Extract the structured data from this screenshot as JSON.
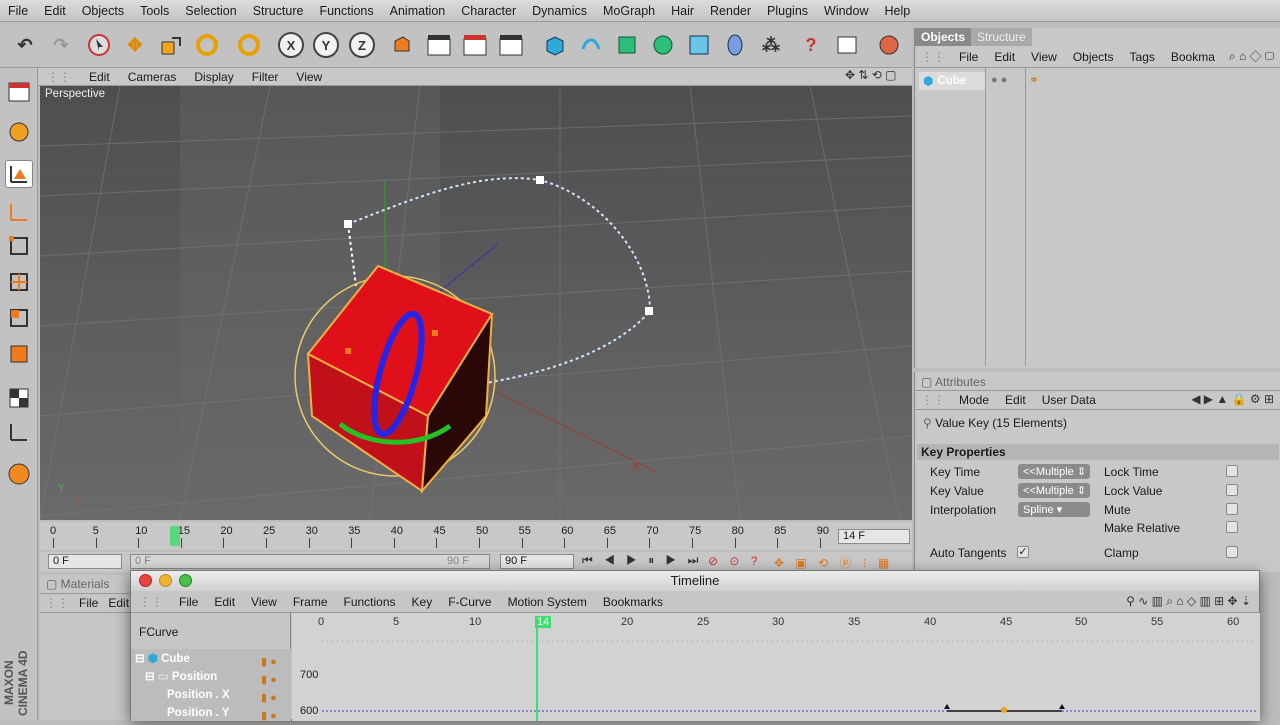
{
  "menu": [
    "File",
    "Edit",
    "Objects",
    "Tools",
    "Selection",
    "Structure",
    "Functions",
    "Animation",
    "Character",
    "Dynamics",
    "MoGraph",
    "Hair",
    "Render",
    "Plugins",
    "Window",
    "Help"
  ],
  "toolbar": {
    "x_label": "X",
    "y_label": "Y",
    "z_label": "Z"
  },
  "viewport": {
    "menu": [
      "Edit",
      "Cameras",
      "Display",
      "Filter",
      "View"
    ],
    "label": "Perspective"
  },
  "ruler": {
    "ticks": [
      "0",
      "5",
      "10",
      "15",
      "20",
      "25",
      "30",
      "35",
      "40",
      "45",
      "50",
      "55",
      "60",
      "65",
      "70",
      "75",
      "80",
      "85",
      "90"
    ],
    "current_frame": "14 F"
  },
  "transport": {
    "start": "0 F",
    "min": "0 F",
    "max": "90 F",
    "end": "90 F"
  },
  "objects_panel": {
    "tabs": [
      "Objects",
      "Structure"
    ],
    "menu": [
      "File",
      "Edit",
      "View",
      "Objects",
      "Tags",
      "Bookma"
    ],
    "object_name": "Cube"
  },
  "attributes": {
    "title": "Attributes",
    "menu": [
      "Mode",
      "Edit",
      "User Data"
    ],
    "header": "Value Key (15 Elements)",
    "section": "Key Properties",
    "key_time_label": "Key Time",
    "key_time_value": "<<Multiple",
    "key_value_label": "Key Value",
    "key_value_value": "<<Multiple",
    "interpolation_label": "Interpolation",
    "interpolation_value": "Spline",
    "lock_time": "Lock Time",
    "lock_value": "Lock Value",
    "mute": "Mute",
    "make_relative": "Make Relative",
    "auto_tangents": "Auto Tangents",
    "clamp": "Clamp"
  },
  "materials": {
    "title": "Materials",
    "menu": [
      "File",
      "Edit"
    ]
  },
  "timeline": {
    "title": "Timeline",
    "menu": [
      "File",
      "Edit",
      "View",
      "Frame",
      "Functions",
      "Key",
      "F-Curve",
      "Motion System",
      "Bookmarks"
    ],
    "mode": "FCurve",
    "ruler": [
      "0",
      "5",
      "10",
      "14",
      "20",
      "25",
      "30",
      "35",
      "40",
      "45",
      "50",
      "55",
      "60"
    ],
    "tree": [
      "Cube",
      "Position",
      "Position . X",
      "Position . Y"
    ],
    "value_ticks": [
      "700",
      "600"
    ]
  },
  "branding": "MAXON CINEMA 4D"
}
